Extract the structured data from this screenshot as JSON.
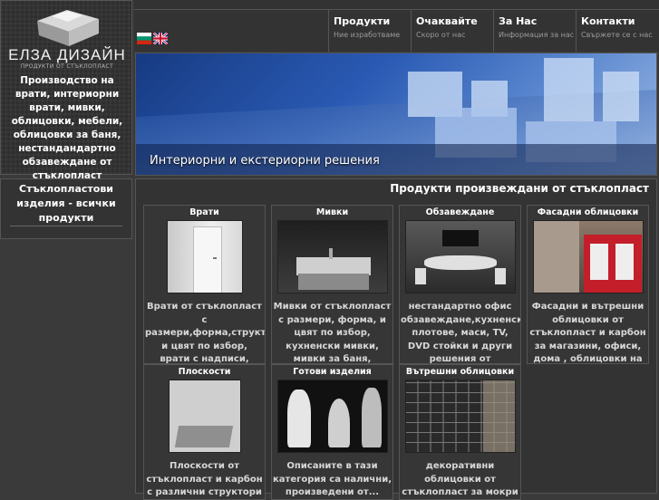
{
  "logo": {
    "title": "ЕЛЗА ДИЗАЙН",
    "subtitle": "ПРОДУКТИ ОТ СТЪКЛОПЛАСТ",
    "description": "Производство на врати, интериорни врати, мивки, облицовки, мебели, облицовки за баня, нестандандартно обзавеждане от стъклопласт"
  },
  "left_nav": {
    "title": "Стъклопластови изделия - всички продукти"
  },
  "languages": [
    {
      "code": "bg",
      "icon": "bulgarian-flag-icon"
    },
    {
      "code": "en",
      "icon": "uk-flag-icon"
    }
  ],
  "menu": [
    {
      "label": "Продукти",
      "sub": "Ние изработваме"
    },
    {
      "label": "Очаквайте",
      "sub": "Скоро от нас"
    },
    {
      "label": "За Нас",
      "sub": "Информация за нас"
    },
    {
      "label": "Контакти",
      "sub": "Свържете се с нас"
    }
  ],
  "banner": {
    "caption": "Интериорни и екстериорни решения"
  },
  "products": {
    "title": "Продукти произвеждани от стъклопласт",
    "items": [
      {
        "title": "Врати",
        "desc": "Врати от стъклопласт с размери,форма,структура и цвят по избор, врати с надписи, входни врати, врати с осветле..."
      },
      {
        "title": "Мивки",
        "desc": "Мивки от стъклопласт с размери, форма, и цвят по избор, кухненски мивки, мивки за баня, луксозни мивки, дизайн..."
      },
      {
        "title": "Обзавеждане",
        "desc": "нестандартно офис обзавеждане,кухненски плотове, маси, TV, DVD стойки и други решения от стъклопласт и карбон..."
      },
      {
        "title": "Фасадни облицовки",
        "desc": "Фасадни и вътрешни облицовки от стъклопласт и карбон за магазини, офиси, дома , облицовки на магазини и сгради..."
      },
      {
        "title": "Плоскости",
        "desc": "Плоскости от стъклопласт и карбон с различни структори и..."
      },
      {
        "title": "Готови изделия",
        "desc": "Описаните в тази категория са налични, произведени от..."
      },
      {
        "title": "Вътрешни облицовки",
        "desc": "декоративни облицовки от стъклопласт за мокри и сухи помещения"
      }
    ]
  },
  "colors": {
    "background": "#3a3a3a",
    "panel": "#333333",
    "border": "#555555",
    "banner_blue": "#2a5ab4"
  }
}
